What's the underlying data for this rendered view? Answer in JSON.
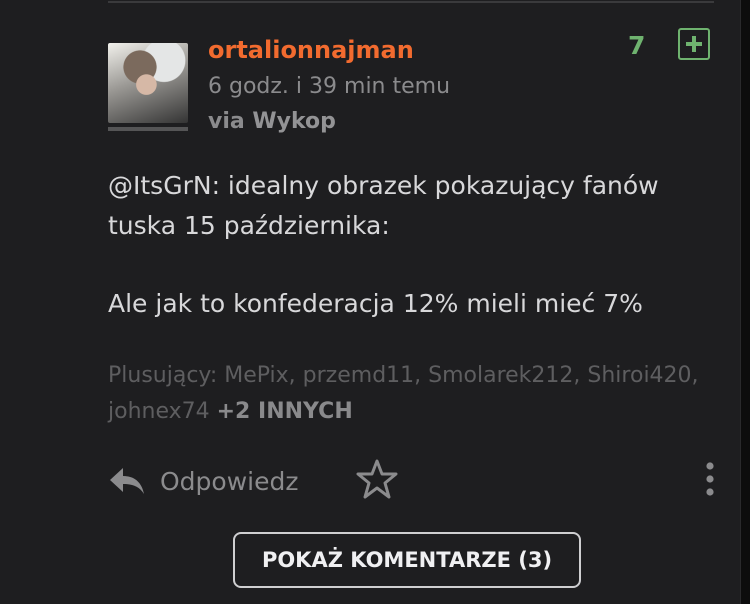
{
  "entry": {
    "author": "ortalionnajman",
    "timestamp": "6 godz. i 39 min temu",
    "via_prefix": "via",
    "via_source": "Wykop",
    "votes": "7",
    "body": {
      "mention": "@ItsGrN",
      "line1": ": idealny obrazek pokazujący fanów tuska 15 października:",
      "line2": "Ale jak to konfederacja 12% mieli mieć 7%"
    },
    "plusers": {
      "prefix": "Plusujący:",
      "names": "MePix, przemd11, Smolarek212, Shiroi420, johnex74",
      "more": "+2 INNYCH"
    },
    "actions": {
      "reply_label": "Odpowiedz"
    },
    "show_comments_label": "POKAŻ KOMENTARZE (3)"
  },
  "colors": {
    "background": "#1e1e20",
    "author": "#f26b2f",
    "vote": "#6fb36f",
    "text": "#d8d8da",
    "muted": "#8b8b8d"
  },
  "icons": {
    "reply": "reply-arrow-icon",
    "favorite": "star-outline-icon",
    "menu": "vertical-dots-icon",
    "upvote": "plus-square-icon"
  }
}
